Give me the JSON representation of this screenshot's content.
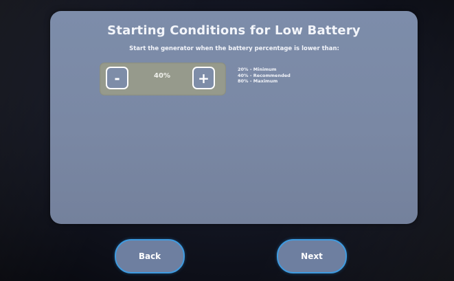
{
  "screen": {
    "title": "Starting Conditions for Low Battery",
    "subtitle": "Start the generator when the battery percentage is lower than:"
  },
  "stepper": {
    "decrement_label": "-",
    "increment_label": "+",
    "value": "40%"
  },
  "hints": [
    "20% - Minimum",
    "40% - Recommended",
    "80% - Maximum"
  ],
  "navigation": {
    "back_label": "Back",
    "next_label": "Next"
  }
}
